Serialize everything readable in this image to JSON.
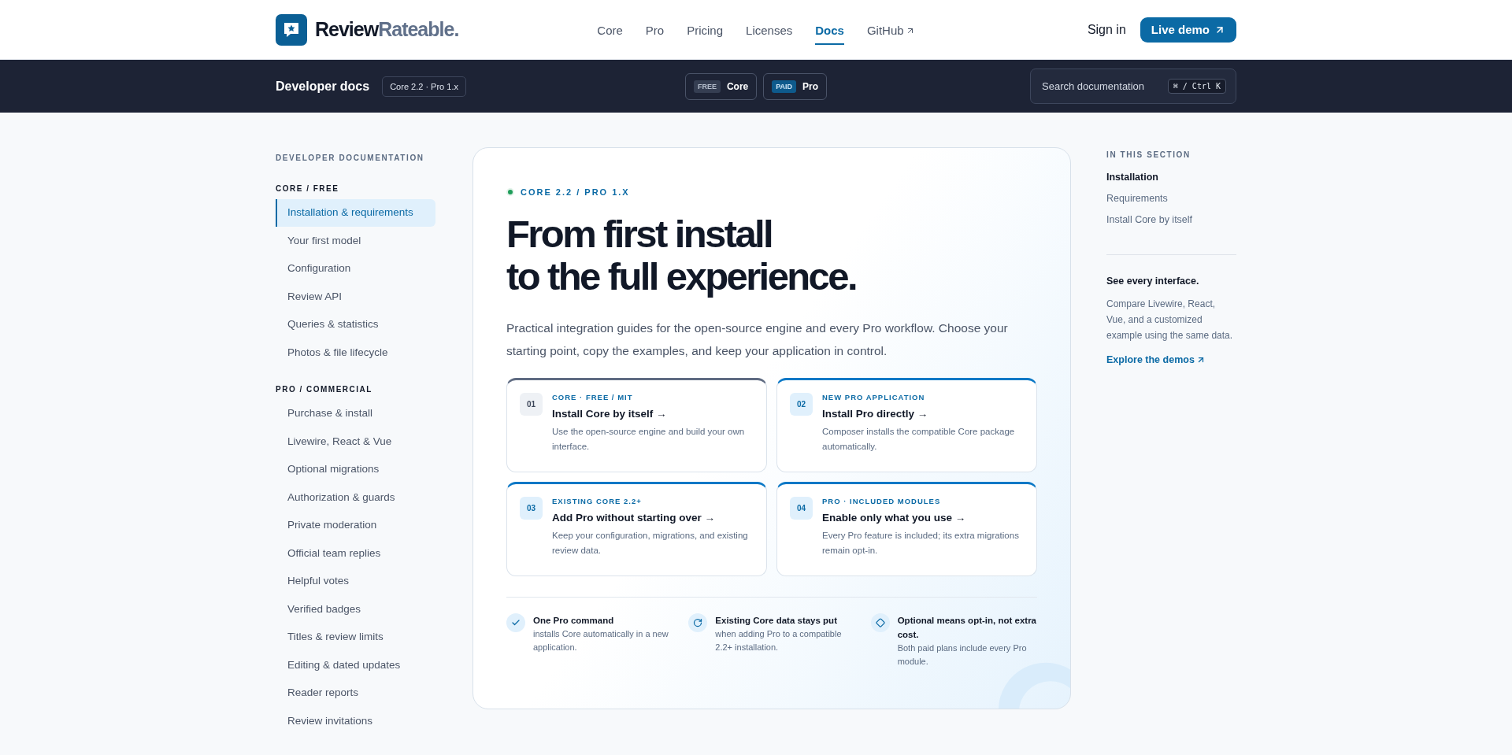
{
  "brand": {
    "primary": "Review",
    "secondary": "Rateable."
  },
  "nav": [
    {
      "label": "Core",
      "selected": false,
      "external": false
    },
    {
      "label": "Pro",
      "selected": false,
      "external": false
    },
    {
      "label": "Pricing",
      "selected": false,
      "external": false
    },
    {
      "label": "Licenses",
      "selected": false,
      "external": false
    },
    {
      "label": "Docs",
      "selected": true,
      "external": false
    },
    {
      "label": "GitHub",
      "selected": false,
      "external": true
    }
  ],
  "sign_in": "Sign in",
  "live_demo": "Live demo",
  "docs_bar": {
    "title": "Developer docs",
    "version": "Core 2.2 · Pro 1.x",
    "editions": [
      {
        "kind": "free",
        "tag": "FREE",
        "label": "Core"
      },
      {
        "kind": "paid",
        "tag": "PAID",
        "label": "Pro"
      }
    ],
    "search": {
      "placeholder": "Search documentation",
      "shortcut": "⌘ / Ctrl K"
    }
  },
  "sidebar": {
    "title": "DEVELOPER DOCUMENTATION",
    "sections": [
      {
        "heading": "CORE / FREE",
        "items": [
          {
            "label": "Installation & requirements",
            "selected": true
          },
          {
            "label": "Your first model",
            "selected": false
          },
          {
            "label": "Configuration",
            "selected": false
          },
          {
            "label": "Review API",
            "selected": false
          },
          {
            "label": "Queries & statistics",
            "selected": false
          },
          {
            "label": "Photos & file lifecycle",
            "selected": false
          }
        ]
      },
      {
        "heading": "PRO / COMMERCIAL",
        "items": [
          {
            "label": "Purchase & install",
            "selected": false
          },
          {
            "label": "Livewire, React & Vue",
            "selected": false
          },
          {
            "label": "Optional migrations",
            "selected": false
          },
          {
            "label": "Authorization & guards",
            "selected": false
          },
          {
            "label": "Private moderation",
            "selected": false
          },
          {
            "label": "Official team replies",
            "selected": false
          },
          {
            "label": "Helpful votes",
            "selected": false
          },
          {
            "label": "Verified badges",
            "selected": false
          },
          {
            "label": "Titles & review limits",
            "selected": false
          },
          {
            "label": "Editing & dated updates",
            "selected": false
          },
          {
            "label": "Reader reports",
            "selected": false
          },
          {
            "label": "Review invitations",
            "selected": false
          }
        ]
      }
    ]
  },
  "hero": {
    "eyebrow": "CORE 2.2 / PRO 1.X",
    "title_lines": [
      "From first install",
      "to the full experience."
    ],
    "intro": "Practical integration guides for the open-source engine and every Pro workflow. Choose your starting point, copy the examples, and keep your application in control.",
    "paths": [
      {
        "kind": "core",
        "number": "01",
        "eyebrow": "CORE · FREE / MIT",
        "title": "Install Core by itself →",
        "text": "Use the open-source engine and build your own interface."
      },
      {
        "kind": "pro",
        "number": "02",
        "eyebrow": "NEW PRO APPLICATION",
        "title": "Install Pro directly →",
        "text": "Composer installs the compatible Core package automatically."
      },
      {
        "kind": "pro",
        "number": "03",
        "eyebrow": "EXISTING CORE 2.2+",
        "title": "Add Pro without starting over →",
        "text": "Keep your configuration, migrations, and existing review data."
      },
      {
        "kind": "pro",
        "number": "04",
        "eyebrow": "PRO · INCLUDED MODULES",
        "title": "Enable only what you use →",
        "text": "Every Pro feature is included; its extra migrations remain opt-in."
      }
    ],
    "features": [
      {
        "kind": "check",
        "title": "One Pro command",
        "text": "installs Core automatically in a new application."
      },
      {
        "kind": "rotate",
        "title": "Existing Core data stays put",
        "text": "when adding Pro to a compatible 2.2+ installation."
      },
      {
        "kind": "diamond",
        "title": "Optional means opt-in, not extra cost.",
        "text": "Both paid plans include every Pro module."
      }
    ]
  },
  "toc": {
    "title": "IN THIS SECTION",
    "items": [
      {
        "label": "Installation",
        "selected": true
      },
      {
        "label": "Requirements",
        "selected": false
      },
      {
        "label": "Install Core by itself",
        "selected": false
      }
    ],
    "aside_title": "See every interface.",
    "aside_text": "Compare Livewire, React, Vue, and a customized example using the same data.",
    "aside_link": "Explore the demos"
  }
}
